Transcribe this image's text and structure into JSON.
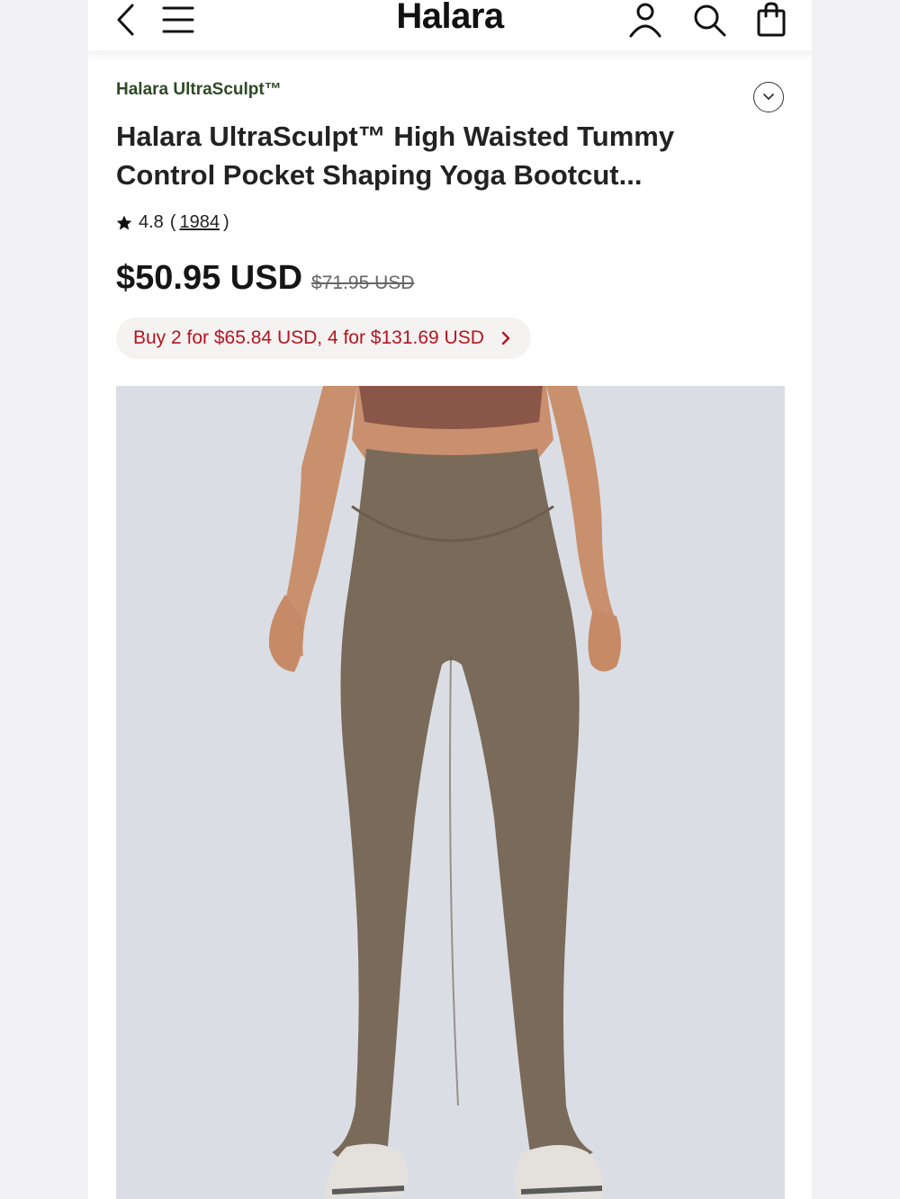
{
  "header": {
    "logo": "Halara",
    "icons": [
      "back-icon",
      "menu-icon",
      "account-icon",
      "search-icon",
      "shopping-bag-icon"
    ]
  },
  "product": {
    "brand": "Halara UltraSculpt™",
    "title": "Halara UltraSculpt™ High Waisted Tummy Control Pocket Shaping Yoga Bootcut...",
    "rating": {
      "value": "4.8",
      "open_paren": "(",
      "count": "1984",
      "close_paren": ")"
    },
    "price": "$50.95 USD",
    "original_price": "$71.95 USD",
    "promo": "Buy 2 for $65.84 USD, 4 for $131.69 USD"
  },
  "colors": {
    "brand_green": "#2e4a25",
    "promo_red": "#b4161f",
    "image_bg": "#dadee4",
    "pants": "#7a6a5a",
    "top": "#8a5648"
  }
}
